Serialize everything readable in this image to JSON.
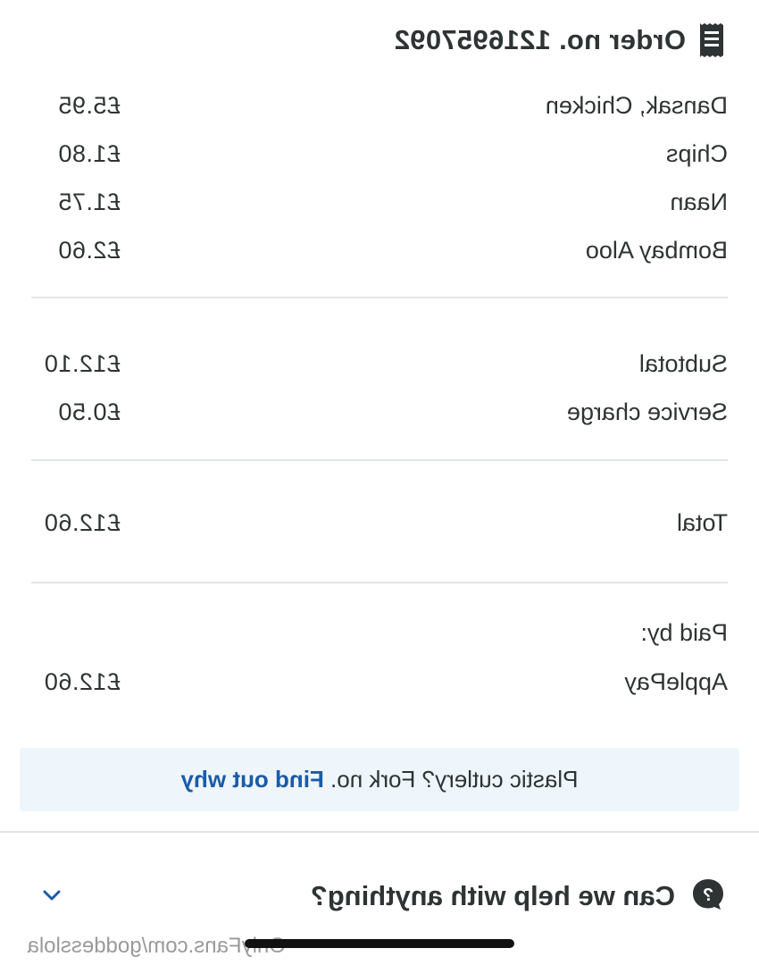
{
  "order": {
    "title": "Order no. 1216957092"
  },
  "items": [
    {
      "name": "Dansak, Chicken",
      "price": "£5.95"
    },
    {
      "name": "Chips",
      "price": "£1.80"
    },
    {
      "name": "Naan",
      "price": "£1.75"
    },
    {
      "name": "Bombay Aloo",
      "price": "£2.60"
    }
  ],
  "summary": {
    "subtotal_label": "Subtotal",
    "subtotal_value": "£12.10",
    "service_label": "Service charge",
    "service_value": "£0.50",
    "total_label": "Total",
    "total_value": "£12.60"
  },
  "payment": {
    "paid_by_label": "Paid by:",
    "method": "ApplePay",
    "amount": "£12.60"
  },
  "banner": {
    "text": "Plastic cutlery? Fork no. ",
    "link_text": "Find out why"
  },
  "help": {
    "label": "Can we help with anything?"
  },
  "watermark": "OnlyFans.com/goddesslola",
  "icons": {
    "receipt": "receipt-icon",
    "help": "question-bubble-icon",
    "expand": "chevron-down-icon"
  },
  "colors": {
    "text": "#2e3333",
    "link": "#1a5ba8",
    "banner_bg": "#eef5fb",
    "divider": "#e2e5e5"
  }
}
